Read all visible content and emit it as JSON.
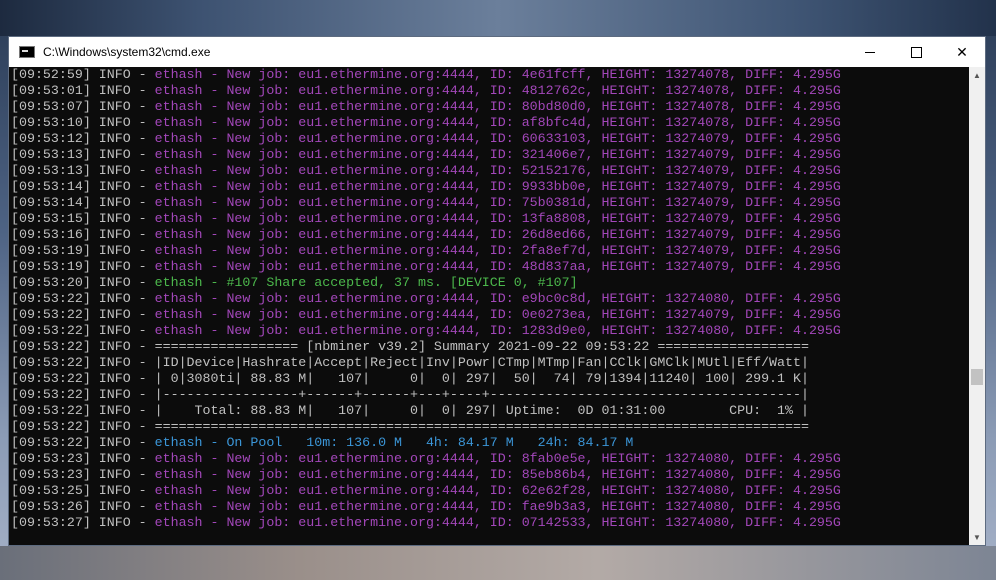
{
  "window": {
    "title": "C:\\Windows\\system32\\cmd.exe"
  },
  "controls": {
    "minimize": "minimize",
    "maximize": "maximize",
    "close": "✕"
  },
  "colors": {
    "purple": "#a347ba",
    "green": "#4cb84c",
    "blue": "#3b96d8",
    "gray": "#c0c0c0"
  },
  "lines": [
    {
      "t": "[09:52:59] INFO - ",
      "c": "purple",
      "m": "ethash - New job: eu1.ethermine.org:4444, ID: 4e61fcff, HEIGHT: 13274078, DIFF: 4.295G"
    },
    {
      "t": "[09:53:01] INFO - ",
      "c": "purple",
      "m": "ethash - New job: eu1.ethermine.org:4444, ID: 4812762c, HEIGHT: 13274078, DIFF: 4.295G"
    },
    {
      "t": "[09:53:07] INFO - ",
      "c": "purple",
      "m": "ethash - New job: eu1.ethermine.org:4444, ID: 80bd80d0, HEIGHT: 13274078, DIFF: 4.295G"
    },
    {
      "t": "[09:53:10] INFO - ",
      "c": "purple",
      "m": "ethash - New job: eu1.ethermine.org:4444, ID: af8bfc4d, HEIGHT: 13274078, DIFF: 4.295G"
    },
    {
      "t": "[09:53:12] INFO - ",
      "c": "purple",
      "m": "ethash - New job: eu1.ethermine.org:4444, ID: 60633103, HEIGHT: 13274079, DIFF: 4.295G"
    },
    {
      "t": "[09:53:13] INFO - ",
      "c": "purple",
      "m": "ethash - New job: eu1.ethermine.org:4444, ID: 321406e7, HEIGHT: 13274079, DIFF: 4.295G"
    },
    {
      "t": "[09:53:13] INFO - ",
      "c": "purple",
      "m": "ethash - New job: eu1.ethermine.org:4444, ID: 52152176, HEIGHT: 13274079, DIFF: 4.295G"
    },
    {
      "t": "[09:53:14] INFO - ",
      "c": "purple",
      "m": "ethash - New job: eu1.ethermine.org:4444, ID: 9933bb0e, HEIGHT: 13274079, DIFF: 4.295G"
    },
    {
      "t": "[09:53:14] INFO - ",
      "c": "purple",
      "m": "ethash - New job: eu1.ethermine.org:4444, ID: 75b0381d, HEIGHT: 13274079, DIFF: 4.295G"
    },
    {
      "t": "[09:53:15] INFO - ",
      "c": "purple",
      "m": "ethash - New job: eu1.ethermine.org:4444, ID: 13fa8808, HEIGHT: 13274079, DIFF: 4.295G"
    },
    {
      "t": "[09:53:16] INFO - ",
      "c": "purple",
      "m": "ethash - New job: eu1.ethermine.org:4444, ID: 26d8ed66, HEIGHT: 13274079, DIFF: 4.295G"
    },
    {
      "t": "[09:53:19] INFO - ",
      "c": "purple",
      "m": "ethash - New job: eu1.ethermine.org:4444, ID: 2fa8ef7d, HEIGHT: 13274079, DIFF: 4.295G"
    },
    {
      "t": "[09:53:19] INFO - ",
      "c": "purple",
      "m": "ethash - New job: eu1.ethermine.org:4444, ID: 48d837aa, HEIGHT: 13274079, DIFF: 4.295G"
    },
    {
      "t": "[09:53:20] INFO - ",
      "c": "green",
      "m": "ethash - #107 Share accepted, 37 ms. [DEVICE 0, #107]"
    },
    {
      "t": "[09:53:22] INFO - ",
      "c": "purple",
      "m": "ethash - New job: eu1.ethermine.org:4444, ID: e9bc0c8d, HEIGHT: 13274080, DIFF: 4.295G"
    },
    {
      "t": "[09:53:22] INFO - ",
      "c": "purple",
      "m": "ethash - New job: eu1.ethermine.org:4444, ID: 0e0273ea, HEIGHT: 13274079, DIFF: 4.295G"
    },
    {
      "t": "[09:53:22] INFO - ",
      "c": "purple",
      "m": "ethash - New job: eu1.ethermine.org:4444, ID: 1283d9e0, HEIGHT: 13274080, DIFF: 4.295G"
    },
    {
      "t": "[09:53:22] INFO - ",
      "c": "gray",
      "m": "================== [nbminer v39.2] Summary 2021-09-22 09:53:22 ==================="
    },
    {
      "t": "[09:53:22] INFO - ",
      "c": "gray",
      "m": "|ID|Device|Hashrate|Accept|Reject|Inv|Powr|CTmp|MTmp|Fan|CClk|GMClk|MUtl|Eff/Watt|"
    },
    {
      "t": "[09:53:22] INFO - ",
      "c": "gray",
      "m": "| 0|3080ti| 88.83 M|   107|     0|  0| 297|  50|  74| 79|1394|11240| 100| 299.1 K|"
    },
    {
      "t": "[09:53:22] INFO - ",
      "c": "gray",
      "m": "|-----------------+------+------+---+----+---------------------------------------|"
    },
    {
      "t": "[09:53:22] INFO - ",
      "c": "gray",
      "m": "|    Total: 88.83 M|   107|     0|  0| 297| Uptime:  0D 01:31:00        CPU:  1% |"
    },
    {
      "t": "[09:53:22] INFO - ",
      "c": "gray",
      "m": "=================================================================================="
    },
    {
      "t": "[09:53:22] INFO - ",
      "c": "blue",
      "m": "ethash - On Pool   10m: 136.0 M   4h: 84.17 M   24h: 84.17 M"
    },
    {
      "t": "[09:53:23] INFO - ",
      "c": "purple",
      "m": "ethash - New job: eu1.ethermine.org:4444, ID: 8fab0e5e, HEIGHT: 13274080, DIFF: 4.295G"
    },
    {
      "t": "[09:53:23] INFO - ",
      "c": "purple",
      "m": "ethash - New job: eu1.ethermine.org:4444, ID: 85eb86b4, HEIGHT: 13274080, DIFF: 4.295G"
    },
    {
      "t": "[09:53:25] INFO - ",
      "c": "purple",
      "m": "ethash - New job: eu1.ethermine.org:4444, ID: 62e62f28, HEIGHT: 13274080, DIFF: 4.295G"
    },
    {
      "t": "[09:53:26] INFO - ",
      "c": "purple",
      "m": "ethash - New job: eu1.ethermine.org:4444, ID: fae9b3a3, HEIGHT: 13274080, DIFF: 4.295G"
    },
    {
      "t": "[09:53:27] INFO - ",
      "c": "purple",
      "m": "ethash - New job: eu1.ethermine.org:4444, ID: 07142533, HEIGHT: 13274080, DIFF: 4.295G"
    }
  ]
}
